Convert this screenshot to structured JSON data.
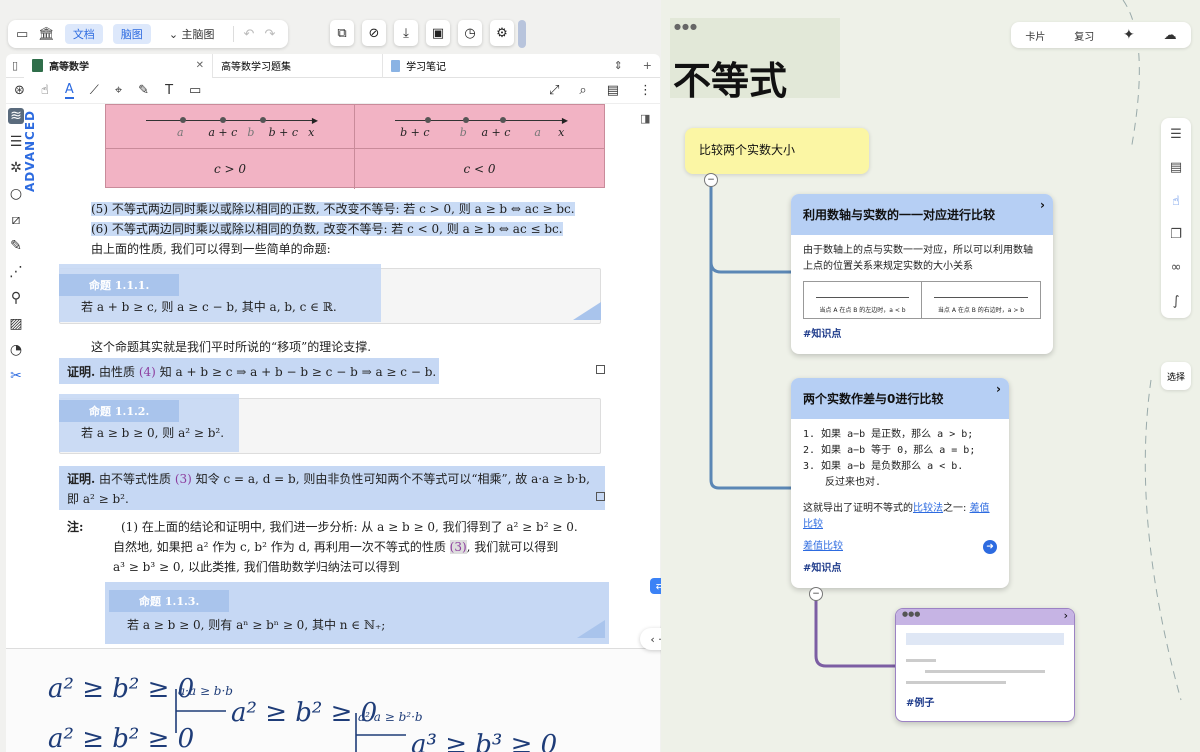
{
  "left_toolbar": {
    "tab_doc": "文档",
    "tab_mindmap": "脑图",
    "main_mindmap": "主脑图"
  },
  "tabs": [
    {
      "label": "高等数学"
    },
    {
      "label": "高等数学习题集"
    },
    {
      "label": "学习笔记"
    }
  ],
  "advanced_label": "ADVANCED",
  "table": {
    "row1_left_labels": [
      "a",
      "a + c",
      "b",
      "b + c",
      "x"
    ],
    "row1_right_labels": [
      "b + c",
      "b",
      "a + c",
      "a",
      "x"
    ],
    "row2_left": "c > 0",
    "row2_right": "c < 0"
  },
  "doc": {
    "prop5": "(5) 不等式两边同时乘以或除以相同的正数, 不改变不等号: 若 c > 0, 则 a ≥ b ⇔ ac ≥ bc.",
    "prop6": "(6) 不等式两边同时乘以或除以相同的负数, 改变不等号: 若 c < 0, 则 a ≥ b ⇔ ac ≤ bc.",
    "intro": "由上面的性质, 我们可以得到一些简单的命题:",
    "p111_title": "命题 1.1.1.",
    "p111_body": "若 a + b ≥ c, 则 a ≥ c − b, 其中 a, b, c ∈ ℝ.",
    "move_note": "这个命题其实就是我们平时所说的“移项”的理论支撑.",
    "proof1_label": "证明.",
    "proof1_a": "由性质",
    "proof1_ref": "(4)",
    "proof1_b": "知 a + b ≥ c ⇒ a + b − b ≥ c − b ⇒ a ≥ c − b.",
    "p112_title": "命题 1.1.2.",
    "p112_body": "若 a ≥ b ≥ 0, 则 a² ≥ b².",
    "proof2_label": "证明.",
    "proof2_a": "由不等式性质",
    "proof2_ref": "(3)",
    "proof2_b": "知令 c = a, d = b, 则由非负性可知两个不等式可以“相乘”, 故 a·a ≥ b·b,",
    "proof2_c": "即 a² ≥ b².",
    "note_label": "注:",
    "note_1": "(1) 在上面的结论和证明中, 我们进一步分析: 从 a ≥ b ≥ 0, 我们得到了 a² ≥ b² ≥ 0.",
    "note_2a": "自然地, 如果把 a² 作为 c, b² 作为 d, 再利用一次不等式的性质",
    "note_ref": "(3)",
    "note_2b": ", 我们就可以得到",
    "note_3": "a³ ≥ b³ ≥ 0, 以此类推, 我们借助数学归纳法可以得到",
    "p113_title": "命题 1.1.3.",
    "p113_body": "若 a ≥ b ≥ 0, 则有 aⁿ ≥ bⁿ ≥ 0, 其中 n ∈ ℕ₊;"
  },
  "handwriting": {
    "l1": "a² ≥ b² ≥ 0",
    "l2": "a² ≥ b² ≥ 0",
    "note1": "a·a ≥ b·b",
    "result1": "a² ≥ b² ≥ 0",
    "note2": "a²·a ≥ b²·b",
    "result2": "a³ ≥ b³ ≥ 0"
  },
  "nav_pill": "‹ · ›",
  "right": {
    "title": "不等式",
    "toolbar": {
      "card": "卡片",
      "review": "复习"
    },
    "select": "选择",
    "root": "比较两个实数大小",
    "node1": {
      "title": "利用数轴与实数的一一对应进行比较",
      "body": "由于数轴上的点与实数一一对应，所以可以利用数轴上点的位置关系来规定实数的大小关系",
      "cap_left": "当点 A 在点 B 的左边时，a < b",
      "cap_right": "当点 A 在点 B 的右边时，a > b",
      "tag": "#知识点"
    },
    "node2": {
      "title": "两个实数作差与0进行比较",
      "items": [
        "1.  如果 a−b 是正数，那么 a > b;",
        "2.  如果 a−b 等于 0，那么 a = b;",
        "3.  如果 a−b 是负数那么 a < b."
      ],
      "reverse": "反过来也对.",
      "summary_a": "这就导出了证明不等式的",
      "summary_link1": "比较法",
      "summary_b": "之一:",
      "summary_link2": "差值比较",
      "link": "差值比较",
      "tag": "#知识点"
    },
    "node3": {
      "tag": "#例子"
    }
  }
}
